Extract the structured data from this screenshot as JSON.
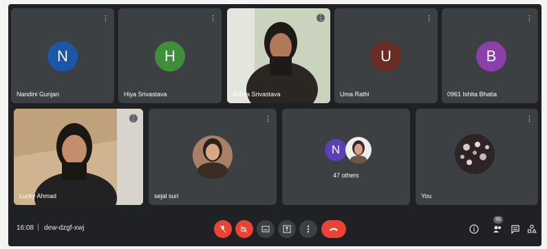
{
  "participants_row1": [
    {
      "name": "Nandini Gunjan",
      "initial": "N",
      "color": "#1a57a6"
    },
    {
      "name": "Hiya Srivastava",
      "initial": "H",
      "color": "#3f8e3a"
    },
    {
      "name": "Ashita Srivastava",
      "initial": "",
      "color": ""
    },
    {
      "name": "Uma Rathi",
      "initial": "U",
      "color": "#6b2c24"
    },
    {
      "name": "0961 Ishita Bhatia",
      "initial": "B",
      "color": "#8c3fa8"
    }
  ],
  "participants_row2": [
    {
      "name": "Lucky Ahmad"
    },
    {
      "name": "sejal suri"
    },
    {
      "name": "47 others",
      "initial": "N",
      "color": "#5b3fb8"
    },
    {
      "name": "You"
    }
  ],
  "meeting": {
    "time": "16:08",
    "separator": "|",
    "code": "dew-dzgf-xwj",
    "participant_count": "55"
  },
  "icons": {
    "mic": "mic-off-icon",
    "camera": "camera-off-icon",
    "captions": "captions-icon",
    "present": "present-screen-icon",
    "more": "more-options-icon",
    "leave": "leave-call-icon",
    "info": "info-icon",
    "people": "people-icon",
    "chat": "chat-icon",
    "activities": "activities-icon"
  }
}
